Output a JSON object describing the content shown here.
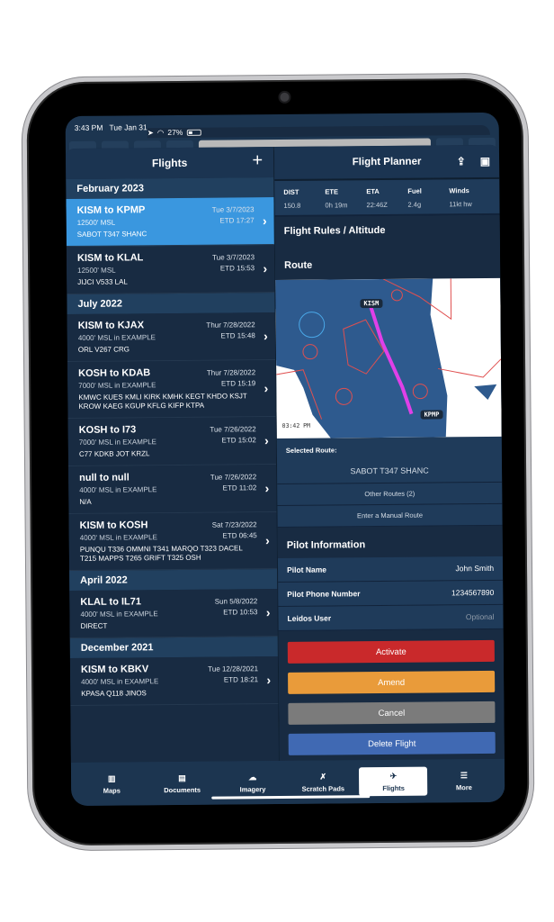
{
  "status_bar": {
    "time": "3:43 PM",
    "date": "Tue Jan 31",
    "battery": "27%"
  },
  "colors": {
    "selected_row": "#3a97df",
    "activate": "#c9292b",
    "amend": "#e99b3a",
    "cancel": "#7b7b7b",
    "delete": "#4069b3",
    "route_line": "#e040e8"
  },
  "flights_panel": {
    "title": "Flights",
    "add_icon": "+",
    "sections": [
      {
        "label": "February 2023",
        "flights": [
          {
            "title": "KISM to KPMP",
            "altitude": "12500' MSL",
            "route": "SABOT T347 SHANC",
            "date": "Tue 3/7/2023",
            "etd": "ETD 17:27",
            "selected": true
          },
          {
            "title": "KISM to KLAL",
            "altitude": "12500' MSL",
            "route": "JIJCI V533 LAL",
            "date": "Tue 3/7/2023",
            "etd": "ETD 15:53"
          }
        ]
      },
      {
        "label": "July 2022",
        "flights": [
          {
            "title": "KISM to KJAX",
            "altitude": "4000' MSL in EXAMPLE",
            "route": "ORL V267 CRG",
            "date": "Thur 7/28/2022",
            "etd": "ETD 15:48"
          },
          {
            "title": "KOSH to KDAB",
            "altitude": "7000' MSL in EXAMPLE",
            "route": "KMWC KUES KMLI KIRK KMHK KEGT KHDO KSJT KROW KAEG KGUP KFLG KIFP KTPA",
            "date": "Thur 7/28/2022",
            "etd": "ETD 15:19"
          },
          {
            "title": "KOSH to I73",
            "altitude": "7000' MSL in EXAMPLE",
            "route": "C77 KDKB JOT KRZL",
            "date": "Tue 7/26/2022",
            "etd": "ETD 15:02"
          },
          {
            "title": "null to null",
            "altitude": "4000' MSL in EXAMPLE",
            "route": "N/A",
            "date": "Tue 7/26/2022",
            "etd": "ETD 11:02"
          },
          {
            "title": "KISM to KOSH",
            "altitude": "4000' MSL in EXAMPLE",
            "route": "PUNQU T336 OMMNI T341 MARQO T323 DACEL T215 MAPPS T265 GRIFT T325 OSH",
            "date": "Sat 7/23/2022",
            "etd": "ETD 06:45"
          }
        ]
      },
      {
        "label": "April 2022",
        "flights": [
          {
            "title": "KLAL to IL71",
            "altitude": "4000' MSL in EXAMPLE",
            "route": "DIRECT",
            "date": "Sun 5/8/2022",
            "etd": "ETD 10:53"
          }
        ]
      },
      {
        "label": "December 2021",
        "flights": [
          {
            "title": "KISM to KBKV",
            "altitude": "4000' MSL in EXAMPLE",
            "route": "KPASA Q118 JINOS",
            "date": "Tue 12/28/2021",
            "etd": "ETD 18:21"
          }
        ]
      }
    ]
  },
  "planner": {
    "title": "Flight Planner",
    "share_icon": "share-icon",
    "save_icon": "save-icon",
    "stats": [
      {
        "label": "DIST",
        "value": "150.8"
      },
      {
        "label": "ETE",
        "value": "0h 19m"
      },
      {
        "label": "ETA",
        "value": "22:46Z"
      },
      {
        "label": "Fuel",
        "value": "2.4g"
      },
      {
        "label": "Winds",
        "value": "11kt hw"
      }
    ],
    "flight_rules_title": "Flight Rules / Altitude",
    "route_title": "Route",
    "map": {
      "origin": "KISM",
      "destination": "KPMP",
      "timestamp": "03:42 PM"
    },
    "selected_route_label": "Selected Route:",
    "selected_route": "SABOT T347 SHANC",
    "other_routes": "Other Routes (2)",
    "manual_route": "Enter a Manual Route",
    "pilot_title": "Pilot Information",
    "pilot_fields": [
      {
        "label": "Pilot Name",
        "value": "John Smith",
        "placeholder": false
      },
      {
        "label": "Pilot Phone Number",
        "value": "1234567890",
        "placeholder": false
      },
      {
        "label": "Leidos User",
        "value": "Optional",
        "placeholder": true
      }
    ],
    "buttons": {
      "activate": "Activate",
      "amend": "Amend",
      "cancel": "Cancel",
      "delete": "Delete Flight"
    }
  },
  "tabbar": [
    {
      "label": "Maps",
      "icon": "map-icon",
      "glyph": "▥"
    },
    {
      "label": "Documents",
      "icon": "document-icon",
      "glyph": "▤"
    },
    {
      "label": "Imagery",
      "icon": "cloud-icon",
      "glyph": "☁"
    },
    {
      "label": "Scratch Pads",
      "icon": "scratchpad-icon",
      "glyph": "✗"
    },
    {
      "label": "Flights",
      "icon": "airplane-icon",
      "glyph": "✈",
      "active": true
    },
    {
      "label": "More",
      "icon": "menu-icon",
      "glyph": "☰"
    }
  ]
}
